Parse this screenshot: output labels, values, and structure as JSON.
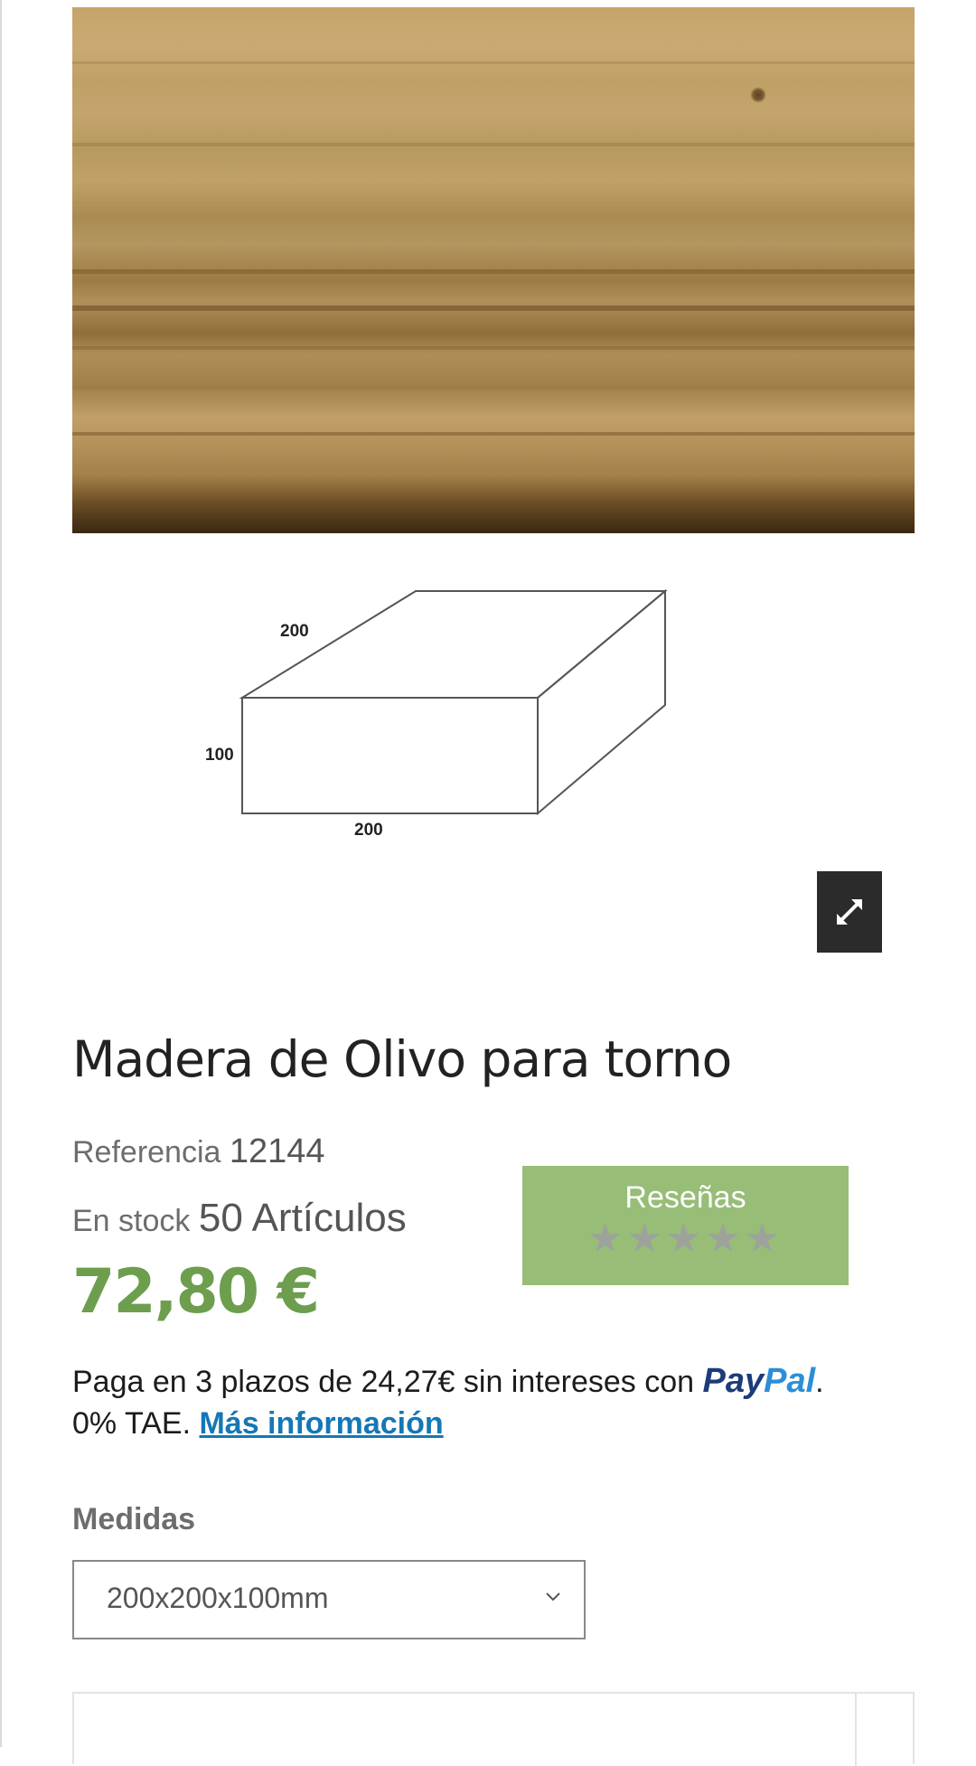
{
  "product": {
    "title": "Madera de Olivo para torno",
    "reference_label": "Referencia",
    "reference_value": "12144",
    "stock_label": "En stock",
    "stock_value": "50 Artículos",
    "price": "72,80 €"
  },
  "gallery": {
    "main_image": "olive-wood-texture",
    "dimension_image": {
      "width_top": "200",
      "height_side": "100",
      "width_bottom": "200"
    },
    "expand_icon": "expand-icon"
  },
  "reviews": {
    "label": "Reseñas",
    "stars": "★★★★★",
    "rating": 0,
    "max": 5
  },
  "paypal": {
    "text_before": "Paga en 3 plazos de 24,27€ sin intereses con ",
    "logo_pay": "Pay",
    "logo_pal": "Pal",
    "text_after": ".",
    "tae": "0% TAE. ",
    "more_link": "Más información"
  },
  "variant": {
    "label": "Medidas",
    "selected": "200x200x100mm",
    "chevron_icon": "chevron-down-icon"
  },
  "colors": {
    "price_green": "#6d9e4e",
    "reviews_green": "#97bd77",
    "link_blue": "#1577b5",
    "paypal_dark": "#1c3b7a",
    "paypal_light": "#2c8ed6"
  }
}
